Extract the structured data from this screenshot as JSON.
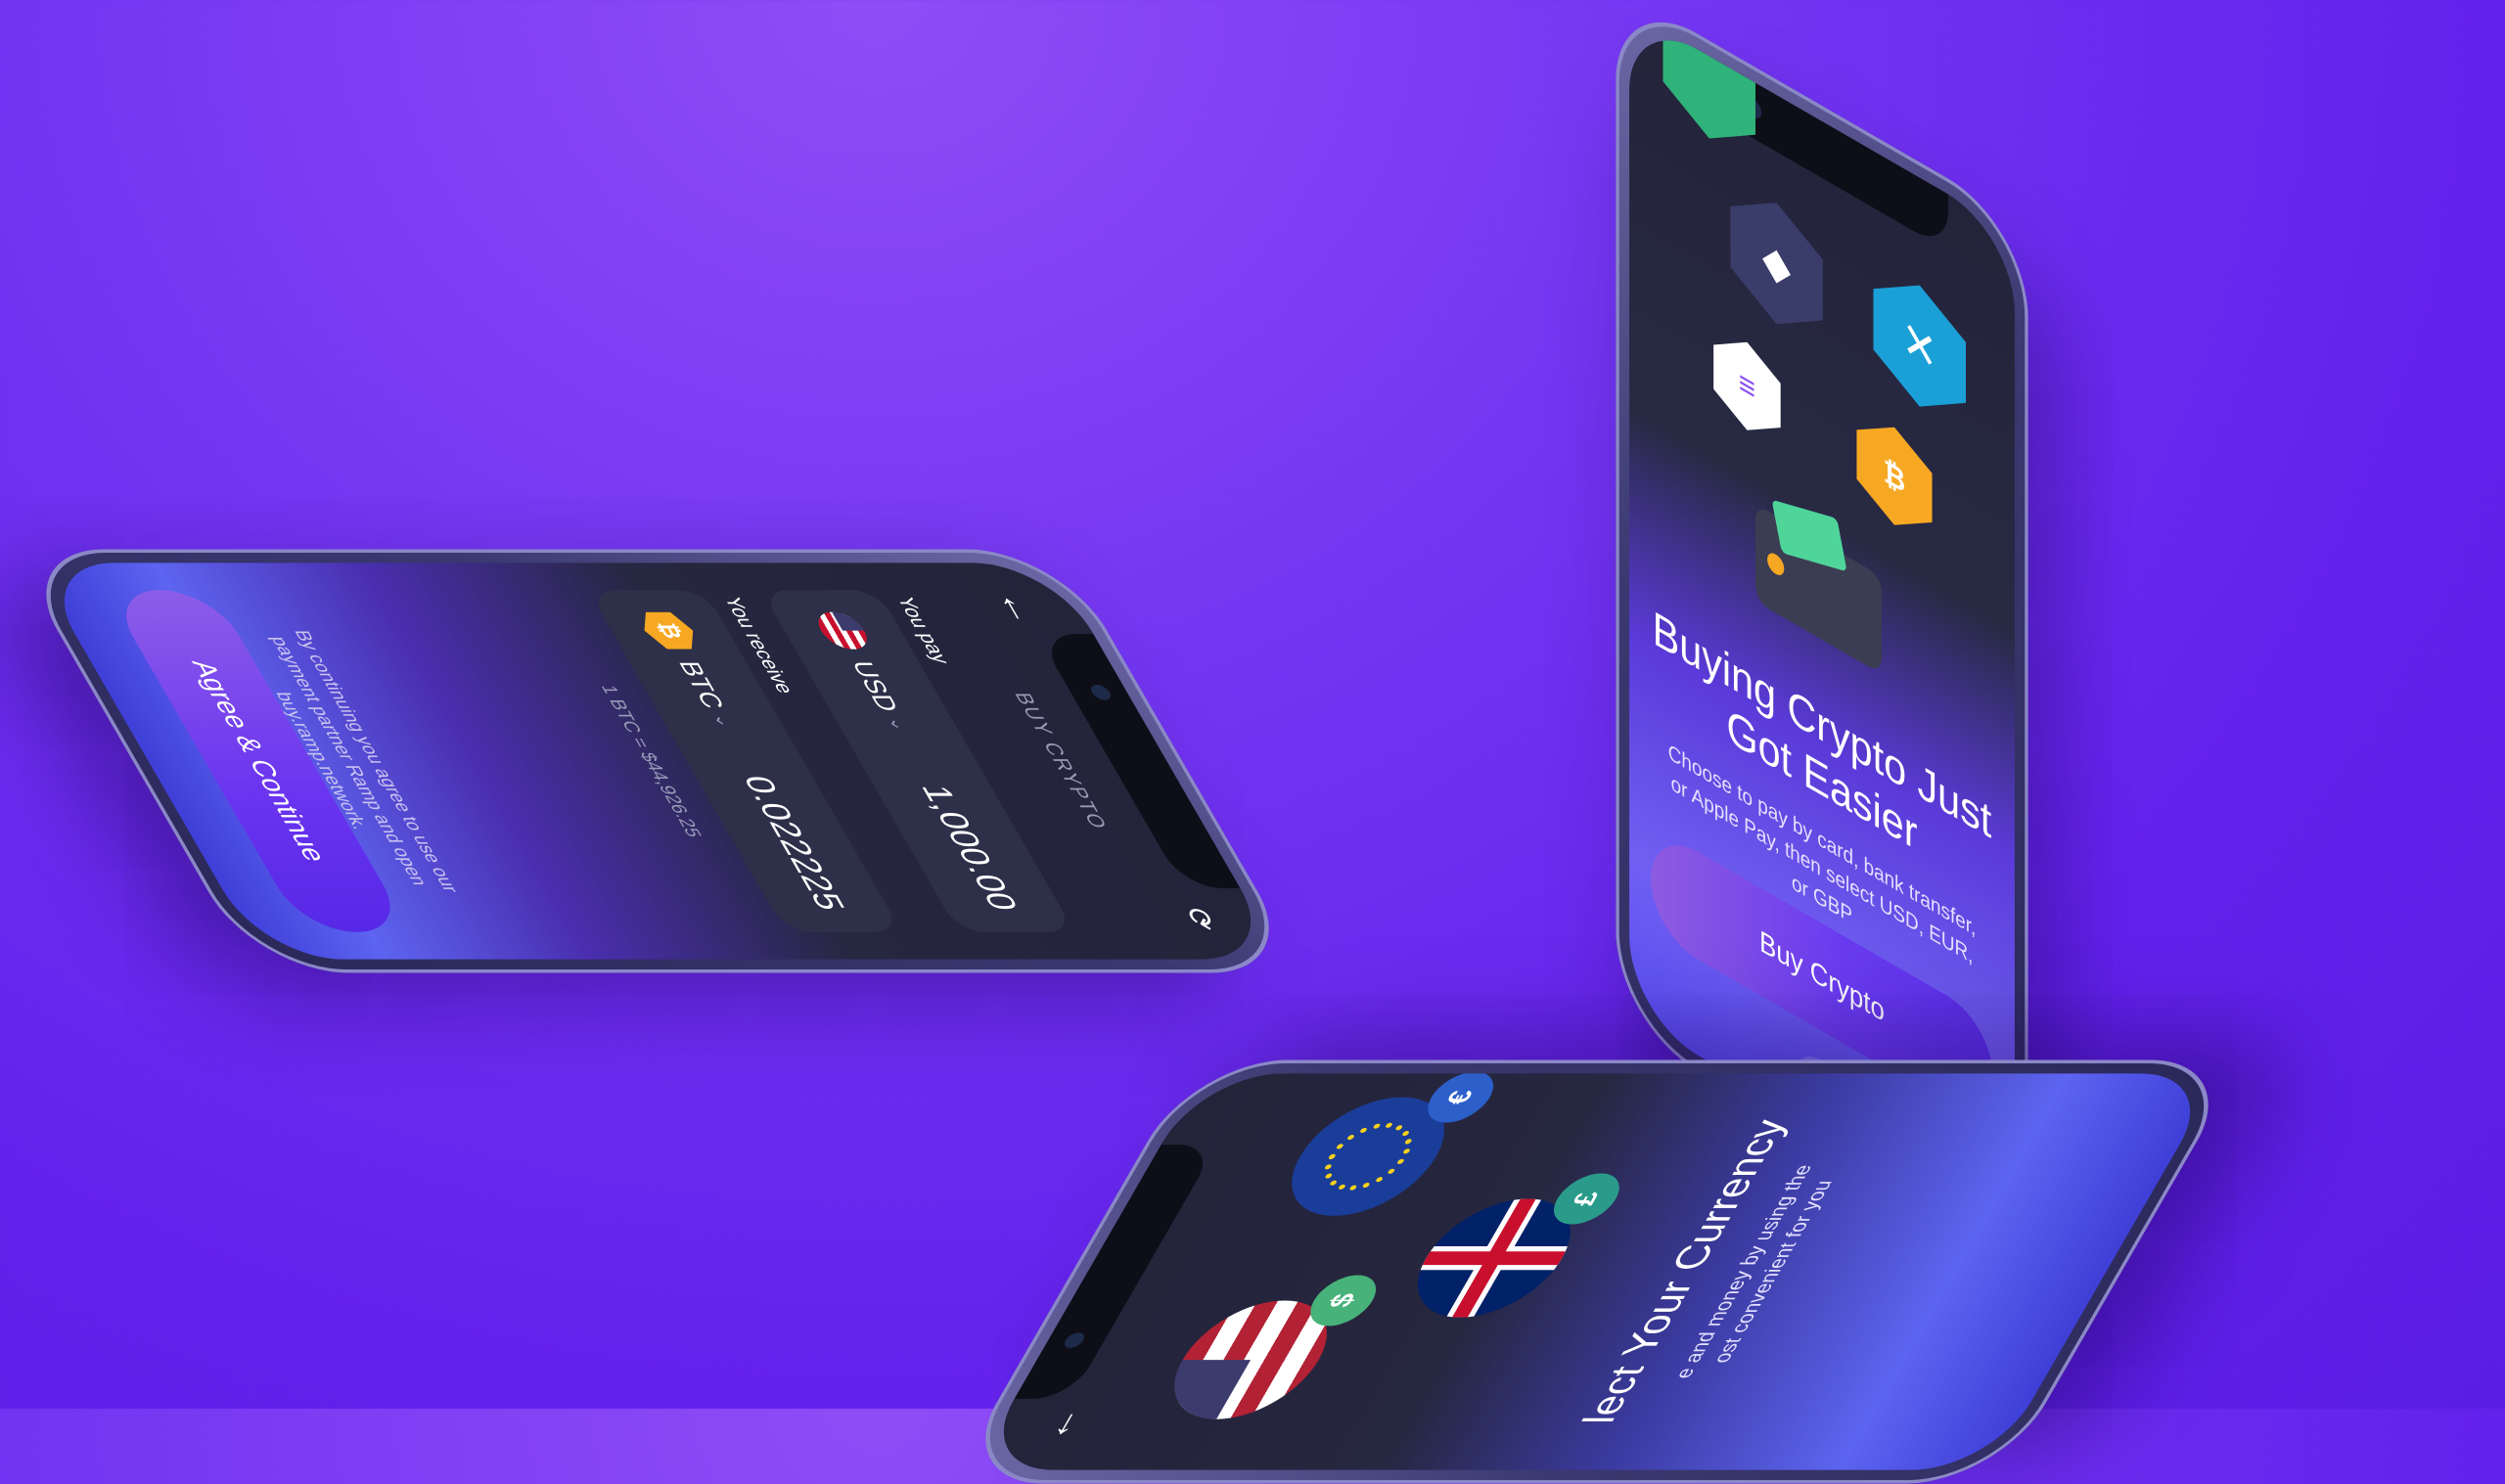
{
  "phone_left": {
    "back_icon": "arrow-left-icon",
    "title": "BUY CRYPTO",
    "you_pay_label": "You pay",
    "pay_currency": "USD",
    "pay_amount": "1,000.00",
    "you_receive_label": "You receive",
    "receive_currency": "BTC",
    "receive_amount": "0.022225",
    "rate": "1 BTC = $44,926.25",
    "legal_text": "By continuing you agree to use our payment partner Ramp and open buy.ramp.network.",
    "cta_label": "Agree & Continue"
  },
  "phone_right": {
    "title_line1": "Buying Crypto Just",
    "title_line2": "Got Easier",
    "description": "Choose to pay by card, bank transfer, or Apple Pay, then select USD, EUR, or GBP",
    "cta_label": "Buy Crypto",
    "close_icon": "close-icon",
    "icons": [
      "ethereum-icon",
      "xrp-icon",
      "solana-icon",
      "bitcoin-icon",
      "wallet-icon"
    ]
  },
  "phone_bottom": {
    "back_icon": "arrow-left-icon",
    "title": "lect Your Currency",
    "description_line1": "e and money by using the",
    "description_line2": "ost convenient for you",
    "currencies": [
      "USD",
      "EUR",
      "GBP"
    ],
    "coin_symbols": [
      "$",
      "€",
      "£"
    ]
  },
  "colors": {
    "background": "#6a2bef",
    "accent": "#7a45f0",
    "btc": "#f7a823",
    "xrp": "#1aa0d6"
  }
}
